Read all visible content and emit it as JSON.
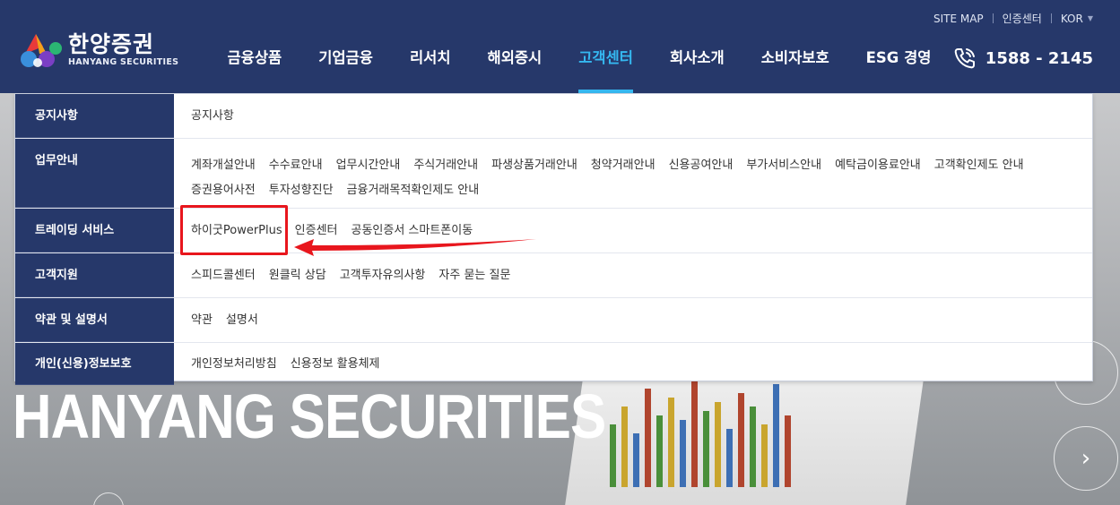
{
  "header": {
    "utility": {
      "sitemap": "SITE MAP",
      "cert_center": "인증센터",
      "lang": "KOR"
    },
    "logo": {
      "kr": "한양증권",
      "en": "HANYANG SECURITIES"
    },
    "nav": [
      "금융상품",
      "기업금융",
      "리서치",
      "해외증시",
      "고객센터",
      "회사소개",
      "소비자보호",
      "ESG 경영"
    ],
    "active_nav": "고객센터",
    "phone": "1588 - 2145"
  },
  "mega_menu": {
    "rows": [
      {
        "category": "공지사항",
        "links": [
          "공지사항"
        ]
      },
      {
        "category": "업무안내",
        "links": [
          "계좌개설안내",
          "수수료안내",
          "업무시간안내",
          "주식거래안내",
          "파생상품거래안내",
          "청약거래안내",
          "신용공여안내",
          "부가서비스안내",
          "예탁금이용료안내",
          "고객확인제도 안내",
          "증권용어사전",
          "투자성향진단",
          "금융거래목적확인제도 안내"
        ]
      },
      {
        "category": "트레이딩 서비스",
        "links": [
          "하이굿PowerPlus",
          "인증센터",
          "공동인증서 스마트폰이동"
        ]
      },
      {
        "category": "고객지원",
        "links": [
          "스피드콜센터",
          "원클릭 상담",
          "고객투자유의사항",
          "자주 묻는 질문"
        ]
      },
      {
        "category": "약관 및 설명서",
        "links": [
          "약관",
          "설명서"
        ]
      },
      {
        "category": "개인(신용)정보보호",
        "links": [
          "개인정보처리방침",
          "신용정보 활용체제"
        ]
      }
    ]
  },
  "hero": {
    "title": "HANYANG SECURITIES"
  },
  "colors": {
    "navy": "#26386a",
    "accent": "#35b8f0",
    "annotation": "#e8161d"
  }
}
